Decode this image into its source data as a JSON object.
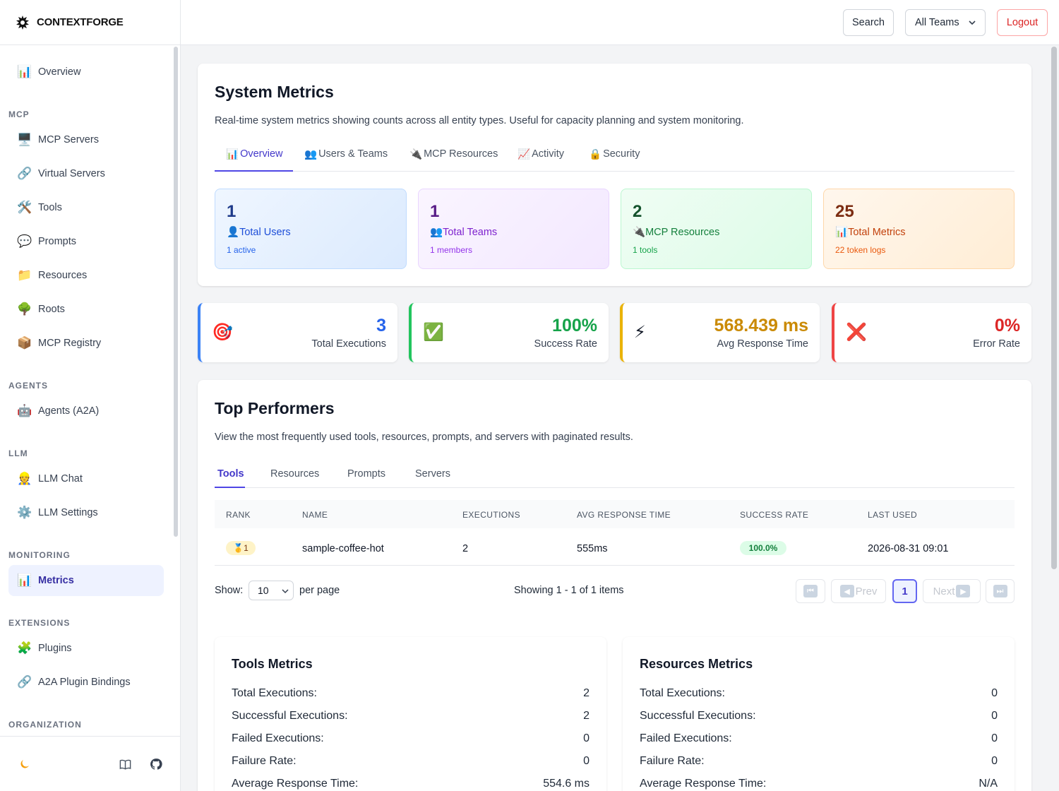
{
  "brand": {
    "name": "CONTEXTFORGE"
  },
  "header": {
    "search_label": "Search",
    "teams_label": "All Teams",
    "logout_label": "Logout"
  },
  "sidebar": {
    "overview": "Overview",
    "sections": {
      "mcp": "MCP",
      "agents": "AGENTS",
      "llm": "LLM",
      "monitoring": "MONITORING",
      "extensions": "EXTENSIONS",
      "organization": "ORGANIZATION"
    },
    "items": {
      "mcp_servers": "MCP Servers",
      "virtual_servers": "Virtual Servers",
      "tools": "Tools",
      "prompts": "Prompts",
      "resources": "Resources",
      "roots": "Roots",
      "mcp_registry": "MCP Registry",
      "agents": "Agents (A2A)",
      "llm_chat": "LLM Chat",
      "llm_settings": "LLM Settings",
      "metrics": "Metrics",
      "plugins": "Plugins",
      "a2a_bindings": "A2A Plugin Bindings"
    },
    "icons": {
      "overview": "📊",
      "mcp_servers": "🖥️",
      "virtual_servers": "🔗",
      "tools": "🛠️",
      "prompts": "💬",
      "resources": "📁",
      "roots": "🌳",
      "mcp_registry": "📦",
      "agents": "🤖",
      "llm_chat": "👷",
      "llm_settings": "⚙️",
      "metrics": "📊",
      "plugins": "🧩",
      "a2a_bindings": "🔗"
    },
    "footer_icons": [
      "moon-icon",
      "book-icon",
      "github-icon"
    ]
  },
  "system_metrics": {
    "title": "System Metrics",
    "description": "Real-time system metrics showing counts across all entity types. Useful for capacity planning and system monitoring.",
    "tabs": [
      {
        "icon": "📊",
        "label": "Overview"
      },
      {
        "icon": "👥",
        "label": "Users & Teams"
      },
      {
        "icon": "🔌",
        "label": "MCP Resources"
      },
      {
        "icon": "📈",
        "label": "Activity"
      },
      {
        "icon": "🔒",
        "label": "Security"
      }
    ],
    "stats": [
      {
        "value": "1",
        "icon": "👤",
        "label": "Total Users",
        "sub": "1 active"
      },
      {
        "value": "1",
        "icon": "👥",
        "label": "Total Teams",
        "sub": "1 members"
      },
      {
        "value": "2",
        "icon": "🔌",
        "label": "MCP Resources",
        "sub": "1 tools"
      },
      {
        "value": "25",
        "icon": "📊",
        "label": "Total Metrics",
        "sub": "22 token logs"
      }
    ]
  },
  "kpis": [
    {
      "icon": "🎯",
      "value": "3",
      "label": "Total Executions",
      "color": "#2563eb"
    },
    {
      "icon": "✅",
      "value": "100%",
      "label": "Success Rate",
      "color": "#16a34a"
    },
    {
      "icon": "⚡",
      "value": "568.439 ms",
      "label": "Avg Response Time",
      "color": "#ca8a04"
    },
    {
      "icon": "❌",
      "value": "0%",
      "label": "Error Rate",
      "color": "#dc2626"
    }
  ],
  "top_performers": {
    "title": "Top Performers",
    "description": "View the most frequently used tools, resources, prompts, and servers with paginated results.",
    "tabs": [
      "Tools",
      "Resources",
      "Prompts",
      "Servers"
    ],
    "columns": [
      "RANK",
      "NAME",
      "EXECUTIONS",
      "AVG RESPONSE TIME",
      "SUCCESS RATE",
      "LAST USED"
    ],
    "rows": [
      {
        "rank": "🥇1",
        "name": "sample-coffee-hot",
        "executions": "2",
        "avg_response": "555ms",
        "success_rate": "100.0%",
        "last_used": "2026-08-31 09:01"
      }
    ],
    "show_label": "Show:",
    "page_size": "10",
    "per_page_label": "per page",
    "showing_text": "Showing 1 - 1 of 1 items",
    "pagination": {
      "first": "⏮",
      "prev": "Prev",
      "current": "1",
      "next": "Next",
      "last": "⏭"
    }
  },
  "tools_metrics": {
    "title": "Tools Metrics",
    "rows": [
      {
        "label": "Total Executions:",
        "value": "2"
      },
      {
        "label": "Successful Executions:",
        "value": "2"
      },
      {
        "label": "Failed Executions:",
        "value": "0"
      },
      {
        "label": "Failure Rate:",
        "value": "0"
      },
      {
        "label": "Average Response Time:",
        "value": "554.6 ms"
      }
    ]
  },
  "resources_metrics": {
    "title": "Resources Metrics",
    "rows": [
      {
        "label": "Total Executions:",
        "value": "0"
      },
      {
        "label": "Successful Executions:",
        "value": "0"
      },
      {
        "label": "Failed Executions:",
        "value": "0"
      },
      {
        "label": "Failure Rate:",
        "value": "0"
      },
      {
        "label": "Average Response Time:",
        "value": "N/A"
      }
    ]
  }
}
